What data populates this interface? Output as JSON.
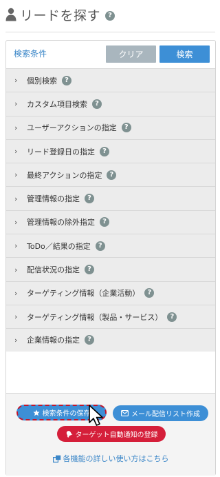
{
  "header": {
    "title": "リードを探す",
    "title_icon": "person-icon",
    "help_glyph": "?"
  },
  "conditions": {
    "label": "検索条件",
    "clear_label": "クリア",
    "search_label": "検索"
  },
  "sections": [
    {
      "label": "個別検索"
    },
    {
      "label": "カスタム項目検索"
    },
    {
      "label": "ユーザーアクションの指定"
    },
    {
      "label": "リード登録日の指定"
    },
    {
      "label": "最終アクションの指定"
    },
    {
      "label": "管理情報の指定"
    },
    {
      "label": "管理情報の除外指定"
    },
    {
      "label": "ToDo／結果の指定"
    },
    {
      "label": "配信状況の指定"
    },
    {
      "label": "ターゲティング情報（企業活動）"
    },
    {
      "label": "ターゲティング情報（製品・サービス）"
    },
    {
      "label": "企業情報の指定"
    }
  ],
  "footer": {
    "save_label": "検索条件の保存",
    "mail_label": "メール配信リスト作成",
    "target_label": "ターゲット自動通知の登録",
    "help_link": "各機能の詳しい使い方はこちら"
  },
  "colors": {
    "primary": "#3d8fd6",
    "danger": "#d51f3a",
    "clear_btn": "#a9b6be",
    "link": "#3a86c8",
    "accordion_bg": "#ececec",
    "help_icon": "#7f9191"
  }
}
